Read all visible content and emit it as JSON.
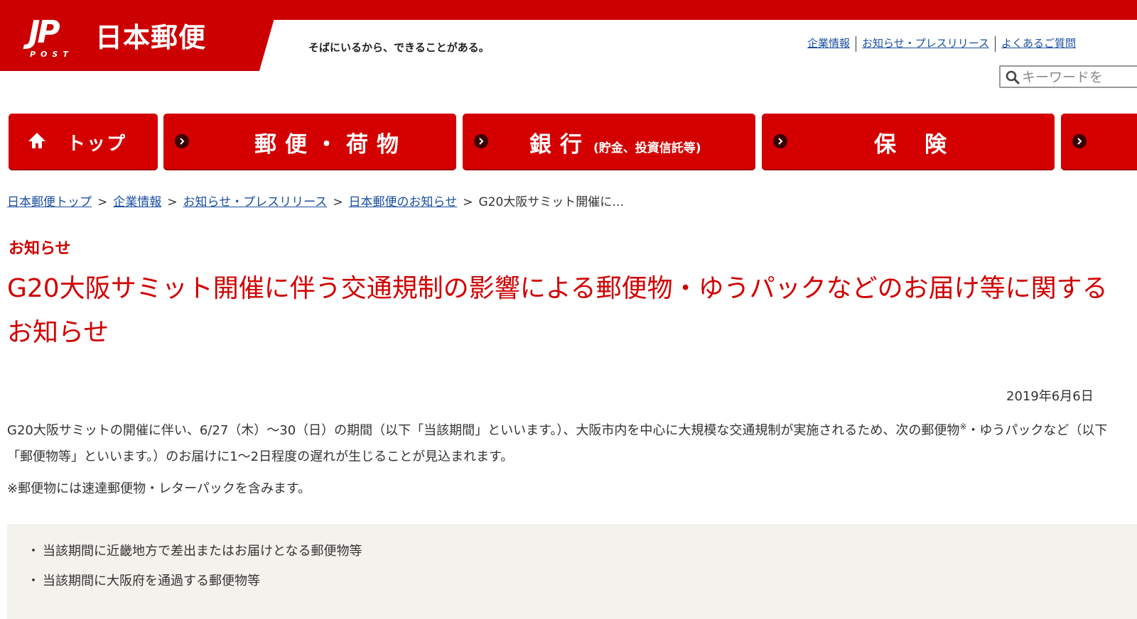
{
  "header": {
    "logo_mark": "JP",
    "logo_post": "POST",
    "logo_name": "日本郵便",
    "tagline": "そばにいるから、できることがある。",
    "links": [
      "企業情報",
      "お知らせ・プレスリリース",
      "よくあるご質問"
    ],
    "search_placeholder": "キーワードを"
  },
  "nav": {
    "top": "トップ",
    "mail": "郵便・荷物",
    "bank": "銀行",
    "bank_sub": "(貯金、投資信託等)",
    "insurance": "保険"
  },
  "breadcrumb": {
    "items": [
      "日本郵便トップ",
      "企業情報",
      "お知らせ・プレスリリース",
      "日本郵便のお知らせ"
    ],
    "current": "G20大阪サミット開催に…"
  },
  "article": {
    "category": "お知らせ",
    "title": "G20大阪サミット開催に伴う交通規制の影響による郵便物・ゆうパックなどのお届け等に関するお知らせ",
    "date": "2019年6月6日",
    "body_part1": "G20大阪サミットの開催に伴い、6/27（木）～30（日）の期間（以下「当該期間」といいます。）、大阪市内を中心に大規模な交通規制が実施されるため、次の郵便物",
    "body_sup": "※",
    "body_part2": "・ゆうパックなど（以下「郵便物等」といいます。）のお届けに1～2日程度の遅れが生じることが見込まれます。",
    "note": "※郵便物には速達郵便物・レターパックを含みます。",
    "list": [
      "当該期間に近畿地方で差出またはお届けとなる郵便物等",
      "当該期間に大阪府を通過する郵便物等"
    ]
  },
  "colors": {
    "brand_red": "#cc0000",
    "link_blue": "#1a4fa0",
    "list_bg": "#f4f2ec"
  }
}
